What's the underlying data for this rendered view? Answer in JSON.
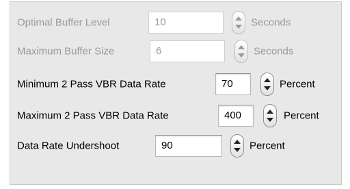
{
  "settings": [
    {
      "label": "Optimal Buffer Level",
      "value": "10",
      "unit": "Seconds",
      "enabled": false
    },
    {
      "label": "Maximum Buffer Size",
      "value": "6",
      "unit": "Seconds",
      "enabled": false
    },
    {
      "label": "Minimum 2 Pass VBR Data Rate",
      "value": "70",
      "unit": "Percent",
      "enabled": true
    },
    {
      "label": "Maximum 2 Pass VBR Data Rate",
      "value": "400",
      "unit": "Percent",
      "enabled": true
    },
    {
      "label": "Data Rate Undershoot",
      "value": "90",
      "unit": "Percent",
      "enabled": true
    }
  ]
}
